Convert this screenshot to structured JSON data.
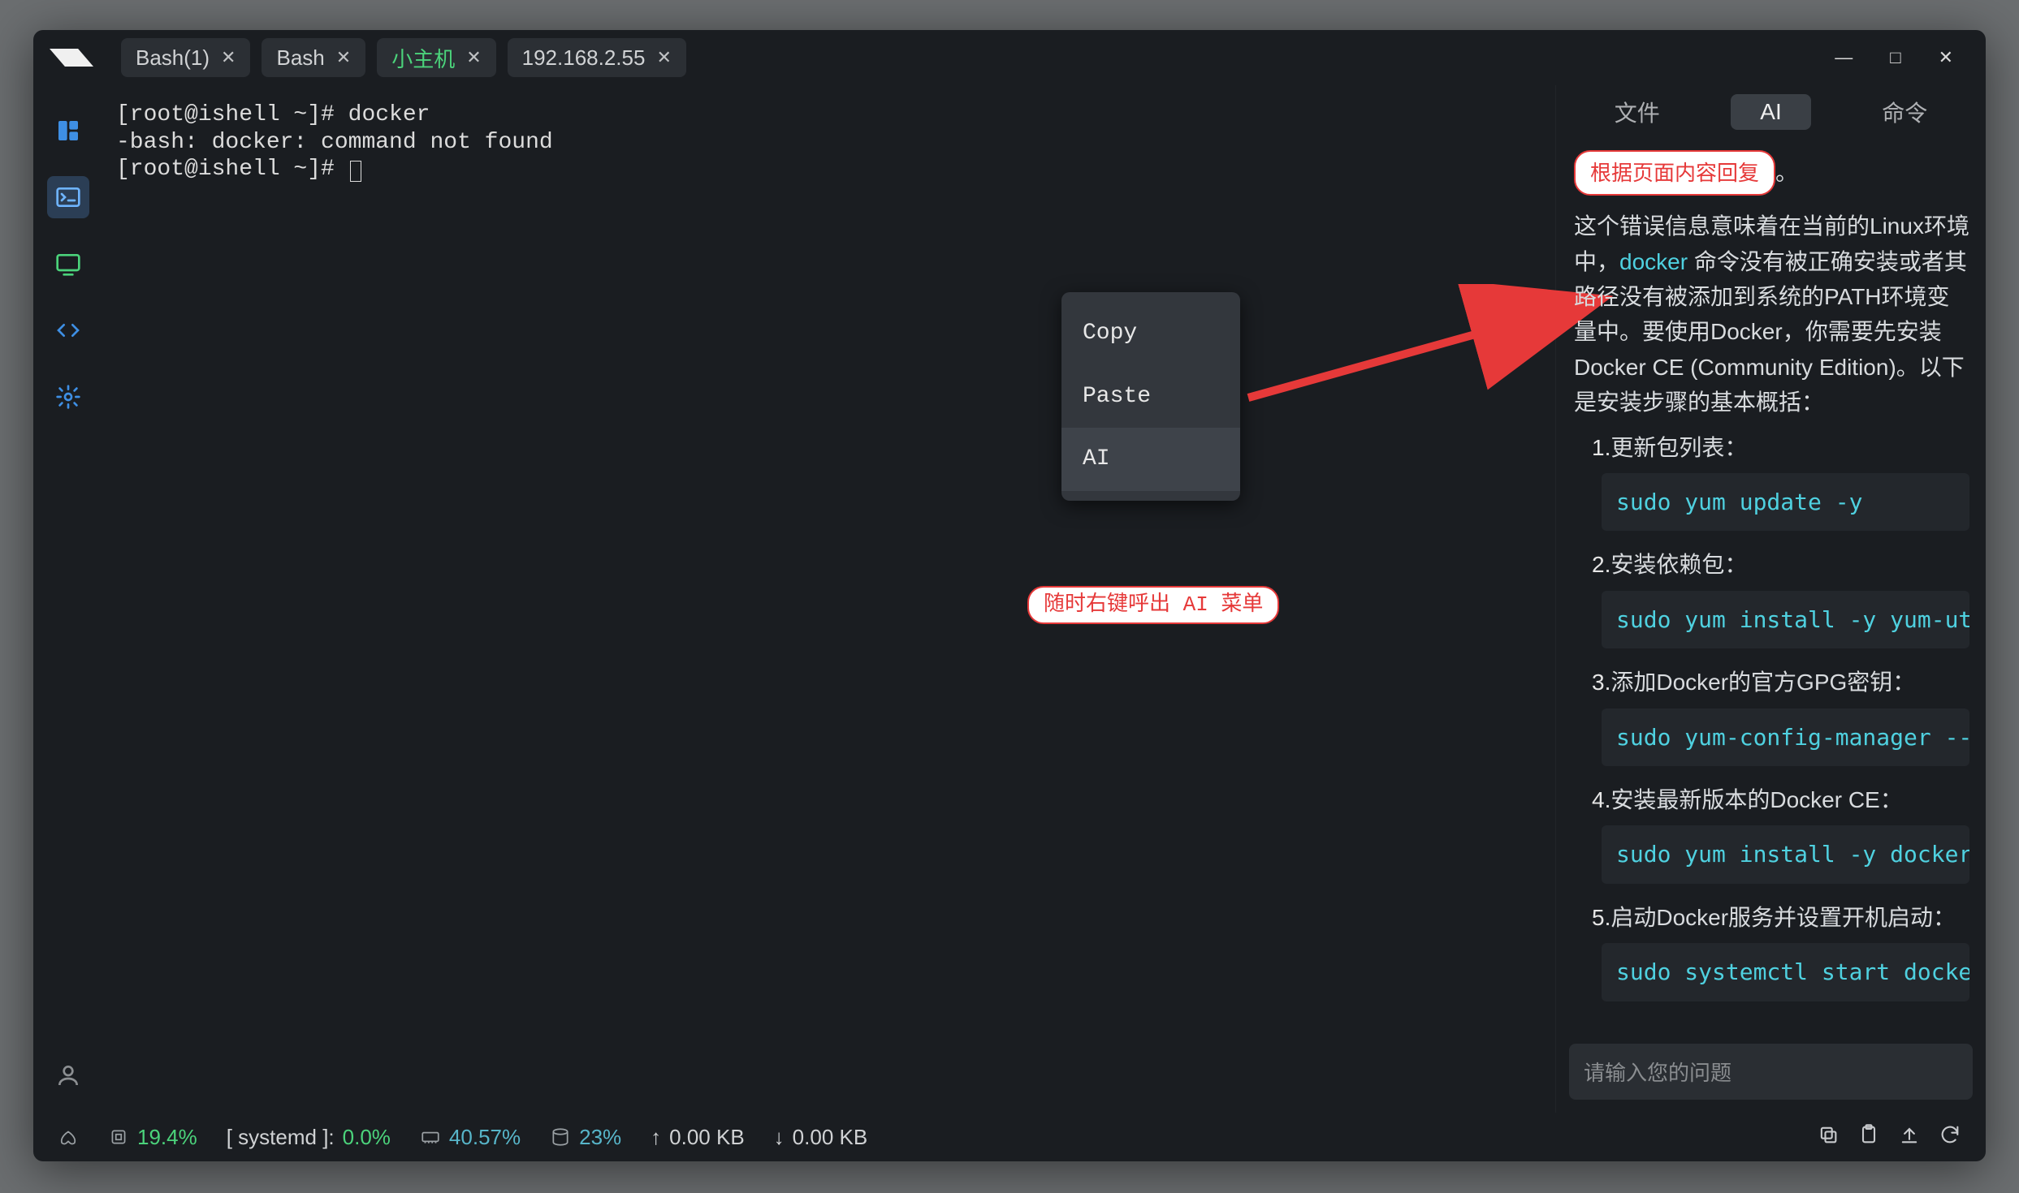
{
  "tabs": [
    {
      "label": "Bash(1)"
    },
    {
      "label": "Bash"
    },
    {
      "label": "小主机",
      "special": true
    },
    {
      "label": "192.168.2.55"
    }
  ],
  "window_controls": {
    "min": "—",
    "max": "□",
    "close": "✕"
  },
  "terminal": {
    "line1": "[root@ishell ~]# docker",
    "line2": "-bash: docker: command not found",
    "line3": "[root@ishell ~]# "
  },
  "context_menu": {
    "copy": "Copy",
    "paste": "Paste",
    "ai": "AI"
  },
  "callouts": {
    "right_click": "随时右键呼出 AI 菜单",
    "reply": "根据页面内容回复"
  },
  "right": {
    "tabs": {
      "file": "文件",
      "ai": "AI",
      "cmd": "命令"
    },
    "top_tail": "。",
    "para_a": "这个错误信息意味着在当前的Linux环境中，",
    "para_kw": "docker",
    "para_b": " 命令没有被正确安装或者其路径没有被添加到系统的PATH环境变量中。要使用Docker，你需要先安装Docker CE (Community Edition)。以下是安装步骤的基本概括：",
    "steps": [
      {
        "n": "1.",
        "t": "更新包列表：",
        "code": "sudo yum update -y"
      },
      {
        "n": "2.",
        "t": "安装依赖包：",
        "code": "sudo yum install -y yum-utils devi"
      },
      {
        "n": "3.",
        "t": "添加Docker的官方GPG密钥：",
        "code": "sudo yum-config-manager --add-"
      },
      {
        "n": "4.",
        "t": "安装最新版本的Docker CE：",
        "code": "sudo yum install -y docker-ce doc"
      },
      {
        "n": "5.",
        "t": "启动Docker服务并设置开机启动：",
        "code": "sudo systemctl start docker"
      }
    ],
    "input_placeholder": "请输入您的问题"
  },
  "status": {
    "cpu": "19.4%",
    "proc_label": "[ systemd ]:",
    "proc_val": "0.0%",
    "mem": "40.57%",
    "disk": "23%",
    "up": "0.00 KB",
    "down": "0.00 KB"
  }
}
